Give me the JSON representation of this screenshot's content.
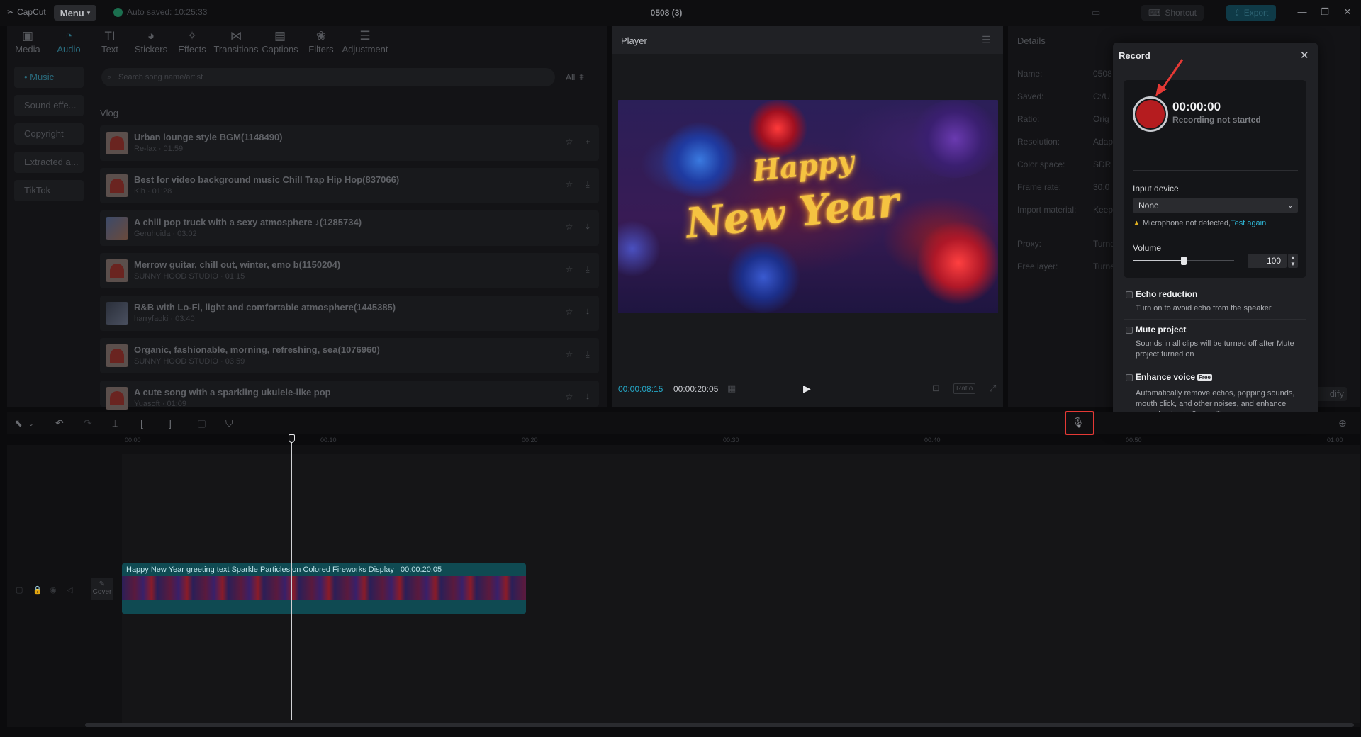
{
  "app": {
    "logo_text": "CapCut",
    "menu_label": "Menu",
    "autosave_text": "Auto saved: 10:25:33",
    "project_title": "0508 (3)",
    "shortcut_label": "Shortcut",
    "export_label": "Export"
  },
  "tabs": [
    {
      "label": "Media",
      "icon": "media-icon"
    },
    {
      "label": "Audio",
      "icon": "audio-icon"
    },
    {
      "label": "Text",
      "icon": "text-icon"
    },
    {
      "label": "Stickers",
      "icon": "stickers-icon"
    },
    {
      "label": "Effects",
      "icon": "effects-icon"
    },
    {
      "label": "Transitions",
      "icon": "transitions-icon"
    },
    {
      "label": "Captions",
      "icon": "captions-icon"
    },
    {
      "label": "Filters",
      "icon": "filters-icon"
    },
    {
      "label": "Adjustment",
      "icon": "adjustment-icon"
    }
  ],
  "categories": [
    "• Music",
    "Sound effe...",
    "Copyright",
    "Extracted a...",
    "TikTok"
  ],
  "search": {
    "placeholder": "Search song name/artist"
  },
  "filter_label": "All",
  "section_title": "Vlog",
  "songs": [
    {
      "title": "Urban lounge style BGM(1148490)",
      "sub": "Re-lax · 01:59"
    },
    {
      "title": "Best for video background music Chill Trap Hip Hop(837066)",
      "sub": "Kih · 01:28"
    },
    {
      "title": "A chill pop truck with a sexy atmosphere ♪(1285734)",
      "sub": "Geruhoida · 03:02"
    },
    {
      "title": "Merrow guitar, chill out, winter, emo b(1150204)",
      "sub": "SUNNY HOOD STUDIO · 01:15"
    },
    {
      "title": "R&B with Lo-Fi, light and comfortable atmosphere(1445385)",
      "sub": "harryfaoki · 03:40"
    },
    {
      "title": "Organic, fashionable, morning, refreshing, sea(1076960)",
      "sub": "SUNNY HOOD STUDIO · 03:59"
    },
    {
      "title": "A cute song with a sparkling ukulele-like pop",
      "sub": "Yuasoft · 01:09"
    }
  ],
  "player": {
    "title": "Player",
    "video_text_1": "Happy",
    "video_text_2": "New Year",
    "current_time": "00:00:08:15",
    "duration": "00:00:20:05",
    "ratio_label": "Ratio"
  },
  "details": {
    "title": "Details",
    "rows": [
      {
        "label": "Name:",
        "value": "0508"
      },
      {
        "label": "Saved:",
        "value": "C:/U"
      },
      {
        "label": "Ratio:",
        "value": "Orig"
      },
      {
        "label": "Resolution:",
        "value": "Adap"
      },
      {
        "label": "Color space:",
        "value": "SDR"
      },
      {
        "label": "Frame rate:",
        "value": "30.0"
      },
      {
        "label": "Import material:",
        "value": "Keep"
      },
      {
        "label": "Proxy:",
        "value": "Turne"
      },
      {
        "label": "Free layer:",
        "value": "Turne"
      }
    ],
    "modify_label": "dify"
  },
  "record": {
    "title": "Record",
    "time": "00:00:00",
    "status": "Recording not started",
    "input_label": "Input device",
    "input_value": "None",
    "mic_warning": "Microphone not detected,",
    "test_again": "Test again",
    "volume_label": "Volume",
    "volume_value": "100",
    "volume_level": 0.5,
    "echo_title": "Echo reduction",
    "echo_desc": "Turn on to avoid echo from the speaker",
    "mute_title": "Mute project",
    "mute_desc": "Sounds in all clips will be turned off after Mute project turned on",
    "enhance_title": "Enhance voice",
    "enhance_badge": "Free",
    "enhance_desc": "Automatically remove echos, popping sounds, mouth click, and other noises, and enhance any voice to studio quality"
  },
  "timeline": {
    "ticks": [
      "00:00",
      "00:10",
      "00:20",
      "00:30",
      "00:40",
      "00:50",
      "01:00"
    ],
    "clip_title": "Happy New Year greeting text Sparkle Particles on Colored Fireworks Display",
    "clip_duration": "00:00:20:05",
    "cover_label": "Cover"
  },
  "colors": {
    "accent": "#25a6c5",
    "record_red": "#b51c1f",
    "highlight_red": "#e53935",
    "clip_teal": "#0f4a52"
  }
}
